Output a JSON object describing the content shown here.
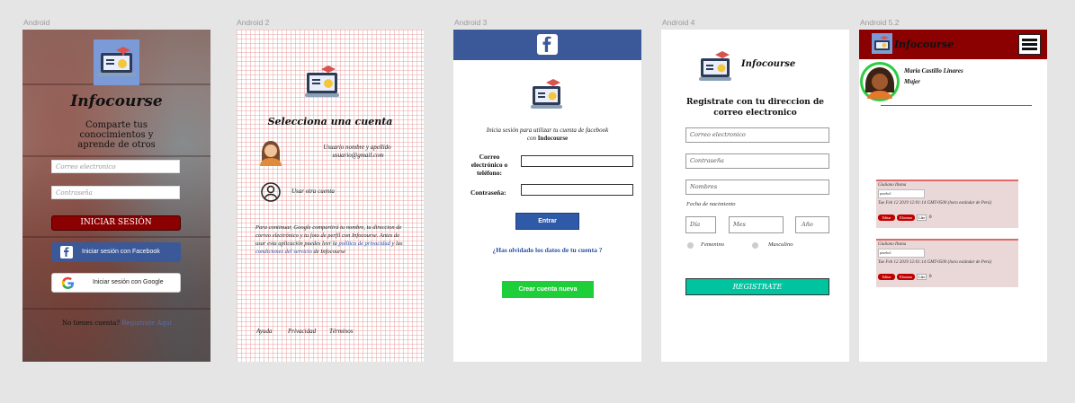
{
  "frames": {
    "f1": "Android",
    "f2": "Android 2",
    "f3": "Android 3",
    "f4": "Android 4",
    "f5": "Android 5.2"
  },
  "screen1": {
    "app_name": "Infocourse",
    "tagline_1": "Comparte tus",
    "tagline_2": "conocimientos y",
    "tagline_3": "aprende de otros",
    "email_placeholder": "Correo electronico",
    "password_placeholder": "Contraseña",
    "login_label": "INICIAR SESIÓN",
    "facebook_label": "Iniciar sesión con Facebook",
    "google_label": "Iniciar sesión con Google",
    "no_account": "No tienes cuenta?",
    "register_link": "Registrate Aquí"
  },
  "screen2": {
    "title": "Selecciona una cuenta",
    "account_name": "Usuario nombre y apellido",
    "account_email": "usuario@gmail.com",
    "other_account": "Usar otra cuenta",
    "disclaimer_1": "Para continuar, Google compartirá tu nombre, tu direccion de correo electrónico y tu foto de perfil con Infocourse. Antes de usar esta aplicación puedes leer la ",
    "privacy_link": "política de privacidad",
    "disclaimer_2": " y las ",
    "terms_link": "condiciones del servicio",
    "disclaimer_3": " de Infocourse",
    "footer_help": "Ayuda",
    "footer_privacy": "Privacidad",
    "footer_terms": "Términos"
  },
  "screen3": {
    "intro_1": "Inicia sesión para utilizar tu cuenta de facebook",
    "intro_2_prefix": "con ",
    "intro_2_app": "Indocourse",
    "email_label_1": "Correo",
    "email_label_2": "electrónico o",
    "email_label_3": "teléfono:",
    "password_label": "Contraseña:",
    "enter_label": "Entrar",
    "forgot_label": "¿Has olvidado los datos de tu cuenta ?",
    "create_label": "Crear cuenta nueva"
  },
  "screen4": {
    "app_name": "Infocourse",
    "heading_1": "Registrate con tu direccion de",
    "heading_2": "correo electronico",
    "email_placeholder": "Correo electronico",
    "password_placeholder": "Contraseña",
    "names_placeholder": "Nombres",
    "birth_label": "Fecha de nacimiento",
    "day_placeholder": "Día",
    "month_placeholder": "Mes",
    "year_placeholder": "Año",
    "female_label": "Femenino",
    "male_label": "Masculino",
    "register_label": "REGISTRATE"
  },
  "screen5": {
    "app_name": "Infocourse",
    "user_name": "Maria Castillo Linares",
    "user_role": "Mujer",
    "posts": [
      {
        "author": "Giuliano Ibsma",
        "text": "prueba1",
        "date": "Tue Feb 12 2019 12:01:14 GMT-0500 (hora estándar de Perú)",
        "edit": "Editar",
        "delete": "Eliminar",
        "like": "Like",
        "count": "0"
      },
      {
        "author": "Giuliano Ibsma",
        "text": "prueba1",
        "date": "Tue Feb 12 2019 12:01:14 GMT-0500 (hora estándar de Perú)",
        "edit": "Editar",
        "delete": "Eliminar",
        "like": "Like",
        "count": "0"
      }
    ]
  },
  "colors": {
    "brand_red": "#8b0000",
    "facebook_blue": "#3b5998",
    "green": "#1fcf3a",
    "teal": "#00c4a0",
    "link_blue": "#2a4fa0"
  }
}
